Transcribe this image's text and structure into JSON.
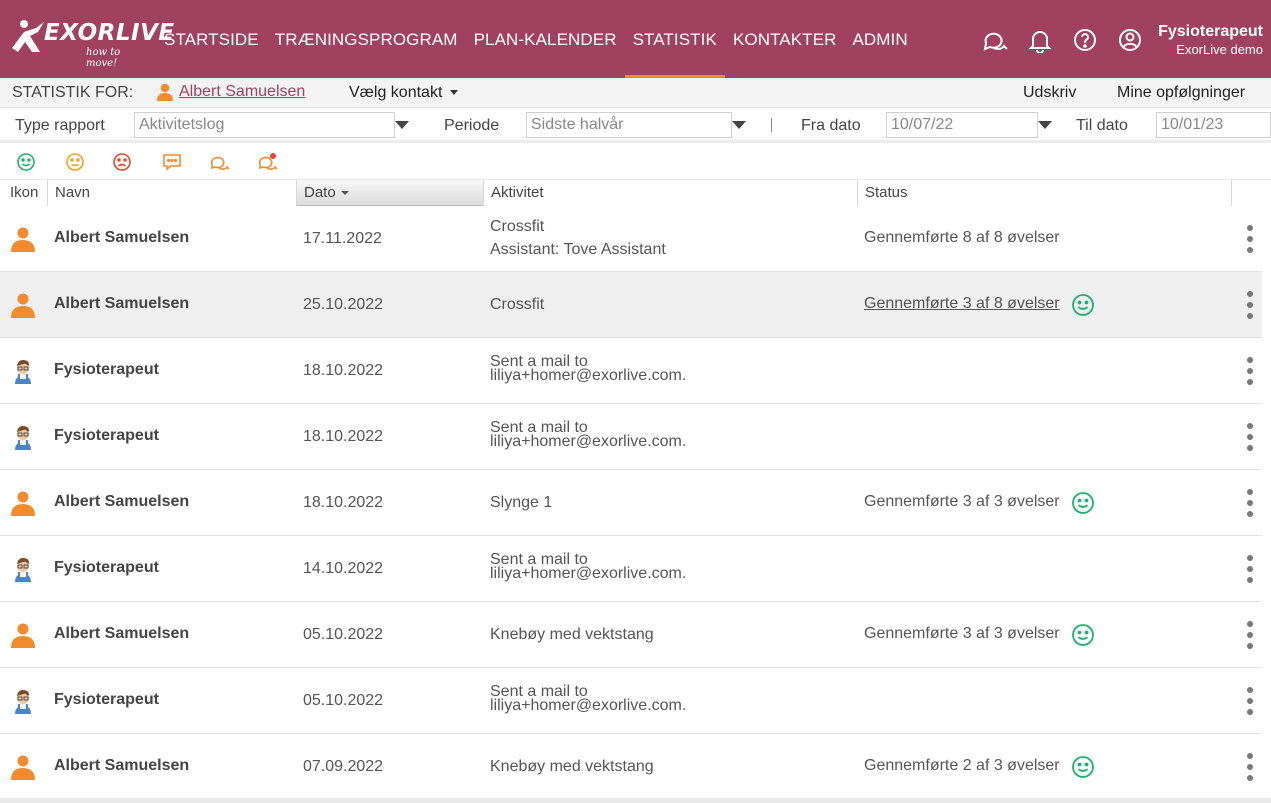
{
  "header": {
    "logo_text": "EXORLIVE",
    "logo_tagline": "how to move!",
    "nav": [
      {
        "label": "STARTSIDE",
        "active": false
      },
      {
        "label": "TRÆNINGSPROGRAM",
        "active": false
      },
      {
        "label": "PLAN-KALENDER",
        "active": false
      },
      {
        "label": "STATISTIK",
        "active": true
      },
      {
        "label": "KONTAKTER",
        "active": false
      },
      {
        "label": "ADMIN",
        "active": false
      }
    ],
    "icons": [
      "chat-icon",
      "bell-icon",
      "help-icon",
      "account-icon"
    ],
    "user_name": "Fysioterapeut",
    "user_org": "ExorLive demo",
    "bg_color": "#a0415f",
    "active_underline_color": "#f28a2e"
  },
  "statistik_bar": {
    "label": "STATISTIK FOR:",
    "person": "Albert Samuelsen",
    "choose_contact": "Vælg kontakt",
    "print": "Udskriv",
    "my_followups": "Mine opfølgninger"
  },
  "filters": {
    "report_type_label": "Type rapport",
    "report_type_value": "Aktivitetslog",
    "period_label": "Periode",
    "period_value": "Sidste halvår",
    "from_label": "Fra dato",
    "from_value": "10/07/22",
    "to_label": "Til dato",
    "to_value": "10/01/23"
  },
  "filter_icons": [
    "smiley-happy-icon",
    "smiley-neutral-icon",
    "smiley-sad-icon",
    "comment-icon",
    "chat-bubbles-icon",
    "chat-alert-icon"
  ],
  "table": {
    "columns": {
      "icon": "Ikon",
      "name": "Navn",
      "date": "Dato",
      "activity": "Aktivitet",
      "status": "Status"
    },
    "rows": [
      {
        "icon": "person",
        "name": "Albert Samuelsen",
        "date": "17.11.2022",
        "activity": "Crossfit",
        "activity2": "Assistant: Tove Assistant",
        "status": "Gennemførte 8 af 8 øvelser",
        "smiley": false,
        "highlight": false,
        "link": false
      },
      {
        "icon": "person",
        "name": "Albert Samuelsen",
        "date": "25.10.2022",
        "activity": "Crossfit",
        "activity2": "",
        "status": "Gennemførte 3 af 8 øvelser",
        "smiley": true,
        "highlight": true,
        "link": true
      },
      {
        "icon": "therapist",
        "name": "Fysioterapeut",
        "date": "18.10.2022",
        "activity": "Sent a mail to",
        "activity2": "liliya+homer@exorlive.com.",
        "status": "",
        "smiley": false,
        "highlight": false,
        "link": false
      },
      {
        "icon": "therapist",
        "name": "Fysioterapeut",
        "date": "18.10.2022",
        "activity": "Sent a mail to",
        "activity2": "liliya+homer@exorlive.com.",
        "status": "",
        "smiley": false,
        "highlight": false,
        "link": false
      },
      {
        "icon": "person",
        "name": "Albert Samuelsen",
        "date": "18.10.2022",
        "activity": "Slynge 1",
        "activity2": "",
        "status": "Gennemførte 3 af 3 øvelser",
        "smiley": true,
        "highlight": false,
        "link": false
      },
      {
        "icon": "therapist",
        "name": "Fysioterapeut",
        "date": "14.10.2022",
        "activity": "Sent a mail to",
        "activity2": "liliya+homer@exorlive.com.",
        "status": "",
        "smiley": false,
        "highlight": false,
        "link": false
      },
      {
        "icon": "person",
        "name": "Albert Samuelsen",
        "date": "05.10.2022",
        "activity": "Knebøy med vektstang",
        "activity2": "",
        "status": "Gennemførte 3 af 3 øvelser",
        "smiley": true,
        "highlight": false,
        "link": false
      },
      {
        "icon": "therapist",
        "name": "Fysioterapeut",
        "date": "05.10.2022",
        "activity": "Sent a mail to",
        "activity2": "liliya+homer@exorlive.com.",
        "status": "",
        "smiley": false,
        "highlight": false,
        "link": false
      },
      {
        "icon": "person",
        "name": "Albert Samuelsen",
        "date": "07.09.2022",
        "activity": "Knebøy med vektstang",
        "activity2": "",
        "status": "Gennemførte 2 af 3 øvelser",
        "smiley": true,
        "highlight": false,
        "link": false
      }
    ]
  }
}
